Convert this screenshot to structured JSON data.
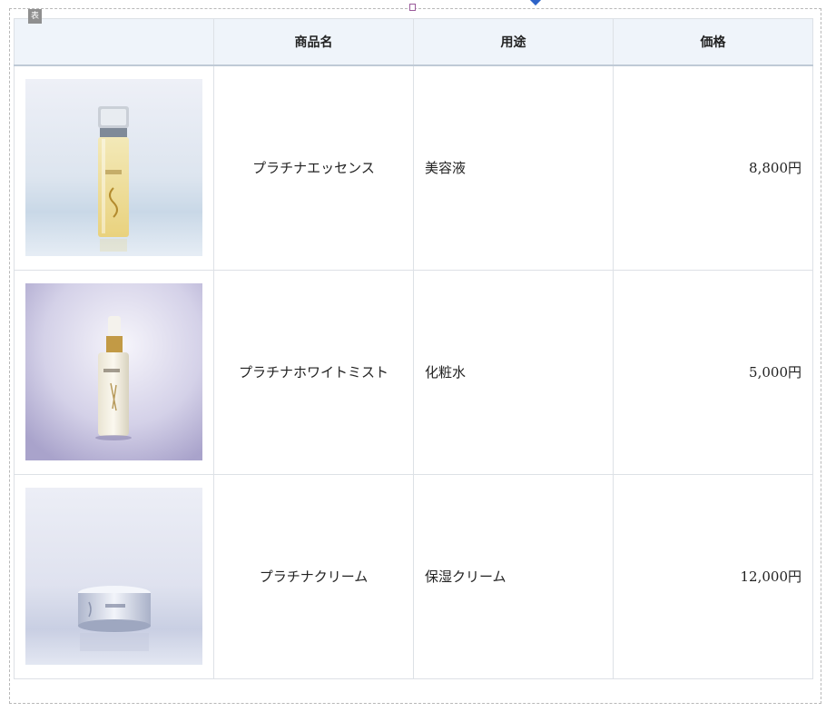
{
  "editor": {
    "block_tag": "表"
  },
  "table": {
    "headers": [
      "",
      "商品名",
      "用途",
      "価格"
    ],
    "rows": [
      {
        "image": "essence-bottle-photo",
        "name": "プラチナエッセンス",
        "use": "美容液",
        "price": "8,800円"
      },
      {
        "image": "mist-bottle-photo",
        "name": "プラチナホワイトミスト",
        "use": "化粧水",
        "price": "5,000円"
      },
      {
        "image": "cream-jar-photo",
        "name": "プラチナクリーム",
        "use": "保湿クリーム",
        "price": "12,000円"
      }
    ]
  },
  "colors": {
    "header_bg": "#eff4fa",
    "border": "#dde1e6",
    "marker": "#2d63c8"
  }
}
